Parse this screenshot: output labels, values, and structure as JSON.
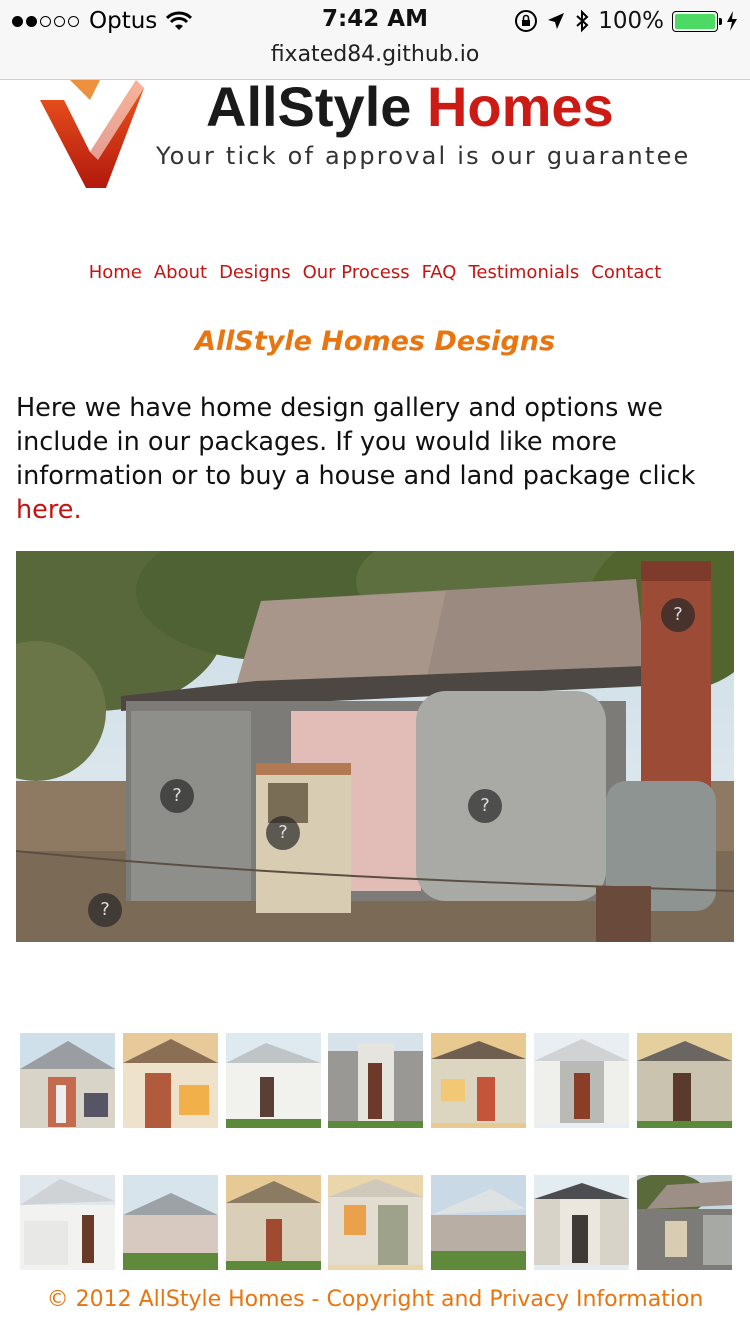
{
  "statusbar": {
    "carrier": "Optus",
    "time": "7:42 AM",
    "battery": "100%",
    "url": "fixated84.github.io",
    "signal_bars_filled": 2,
    "signal_bars_total": 5
  },
  "logo": {
    "name_part1": "AllStyle",
    "name_part2": "Homes",
    "tagline": "Your tick of approval is our guarantee"
  },
  "nav": {
    "items": [
      {
        "label": "Home"
      },
      {
        "label": "About"
      },
      {
        "label": "Designs"
      },
      {
        "label": "Our Process"
      },
      {
        "label": "FAQ"
      },
      {
        "label": "Testimonials"
      },
      {
        "label": "Contact"
      }
    ]
  },
  "main": {
    "title": "AllStyle Homes Designs",
    "intro_text": "Here we have home design gallery and options we include in our packages. If you would like more information or to buy a house and land package click",
    "intro_link": "here.",
    "hotspot_label": "?"
  },
  "footer": {
    "text": "© 2012 AllStyle Homes - Copyright and Privacy Information"
  },
  "colors": {
    "link_red": "#c41412",
    "accent_orange": "#e8750f"
  }
}
